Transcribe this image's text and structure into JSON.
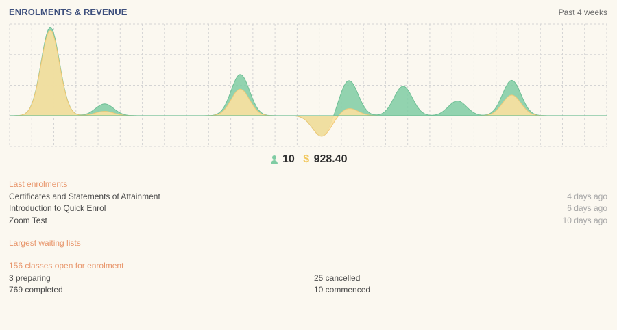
{
  "header": {
    "title": "ENROLMENTS & REVENUE",
    "period": "Past 4 weeks"
  },
  "totals": {
    "enrolments": "10",
    "revenue": "928.40",
    "revenue_symbol": "$"
  },
  "colors": {
    "enrolments": "#7fcca3",
    "revenue": "#fbe0a0",
    "accent": "#e8956a",
    "title": "#3d4f7c"
  },
  "chart_data": {
    "type": "area",
    "series": [
      {
        "name": "Enrolments",
        "values": [
          0,
          3,
          0,
          0.4,
          0,
          0,
          0,
          0,
          1.4,
          0,
          0,
          -0.7,
          1.2,
          0,
          1.0,
          0,
          0.5,
          0,
          1.2,
          0,
          0,
          0
        ]
      },
      {
        "name": "Revenue",
        "values": [
          0,
          2.9,
          0,
          0.15,
          0,
          0,
          0,
          0,
          0.9,
          0,
          0,
          -0.7,
          0.25,
          0,
          0,
          0,
          0,
          0,
          0.7,
          0,
          0,
          0
        ]
      }
    ],
    "grid": true
  },
  "last_enrolments": {
    "title": "Last enrolments",
    "items": [
      {
        "name": "Certificates and Statements of Attainment",
        "time": "4 days ago"
      },
      {
        "name": "Introduction to Quick Enrol",
        "time": "6 days ago"
      },
      {
        "name": "Zoom Test",
        "time": "10 days ago"
      }
    ]
  },
  "waiting_lists": {
    "title": "Largest waiting lists"
  },
  "classes": {
    "title": "156 classes open for enrolment",
    "preparing": "3 preparing",
    "completed": "769 completed",
    "cancelled": "25 cancelled",
    "commenced": "10 commenced"
  }
}
